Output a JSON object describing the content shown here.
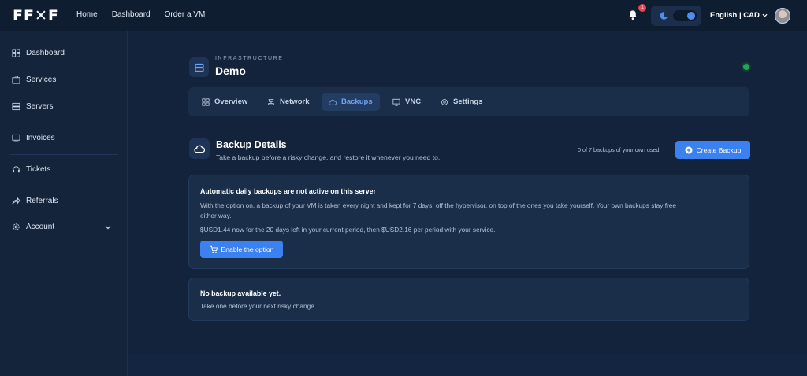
{
  "topbar": {
    "logo": "FF✕F",
    "nav": [
      "Home",
      "Dashboard",
      "Order a VM"
    ],
    "notification_count": "1",
    "language_currency": "English | CAD"
  },
  "sidebar": {
    "items": [
      {
        "label": "Dashboard",
        "icon": "grid-icon"
      },
      {
        "label": "Services",
        "icon": "box-icon"
      },
      {
        "label": "Servers",
        "icon": "server-icon"
      },
      {
        "label": "Invoices",
        "icon": "invoice-icon"
      },
      {
        "label": "Tickets",
        "icon": "headset-icon"
      },
      {
        "label": "Referrals",
        "icon": "share-icon"
      },
      {
        "label": "Account",
        "icon": "gear-icon"
      }
    ]
  },
  "page": {
    "eyebrow": "INFRASTRUCTURE",
    "title": "Demo",
    "status_color": "#22a55a"
  },
  "tabs": [
    {
      "label": "Overview",
      "active": false
    },
    {
      "label": "Network",
      "active": false
    },
    {
      "label": "Backups",
      "active": true
    },
    {
      "label": "VNC",
      "active": false
    },
    {
      "label": "Settings",
      "active": false
    }
  ],
  "backup": {
    "title": "Backup Details",
    "subtitle": "Take a backup before a risky change, and restore it whenever you need to.",
    "usage": "0 of 7 backups of your own used",
    "create_label": "Create Backup"
  },
  "auto_card": {
    "title": "Automatic daily backups are not active on this server",
    "line1": "With the option on, a backup of your VM is taken every night and kept for 7 days, off the hypervisor, on top of the ones you take yourself. Your own backups stay free",
    "line2": "either way.",
    "pricing": "$USD1.44 now for the 20 days left in your current period, then $USD2.16 per period with your service.",
    "button": "Enable the option"
  },
  "empty_card": {
    "title": "No backup available yet.",
    "text": "Take one before your next risky change."
  },
  "colors": {
    "accent": "#3b82f0",
    "background": "#13233b"
  }
}
